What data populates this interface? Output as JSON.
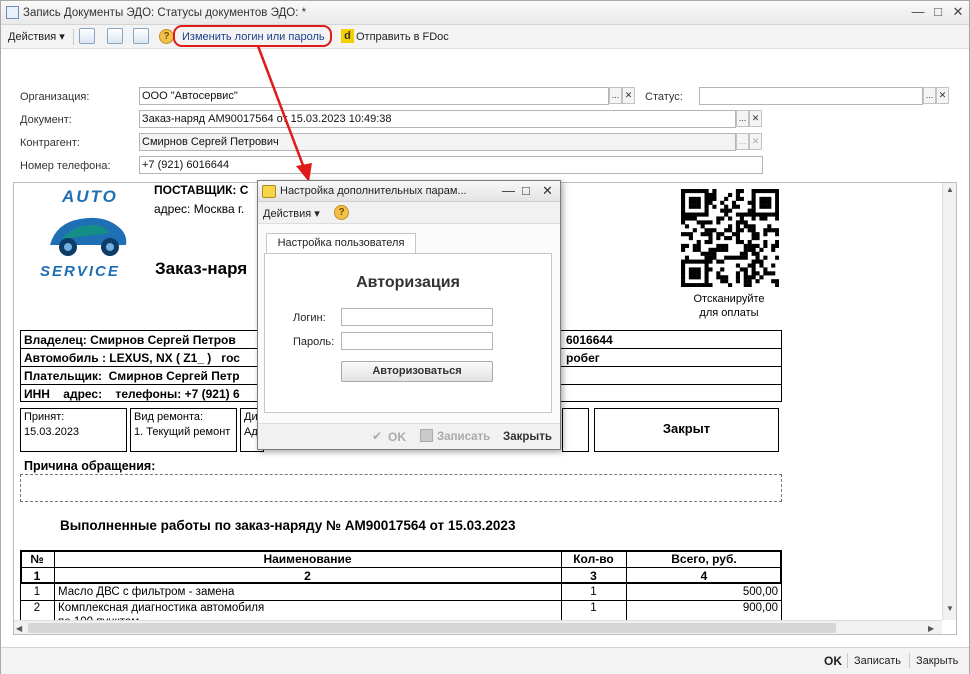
{
  "window": {
    "title": "Запись Документы ЭДО: Статусы документов ЭДО: *"
  },
  "toolbar": {
    "actions": "Действия",
    "change_login": "Изменить логин или пароль",
    "send_fdoc": "Отправить в FDoc"
  },
  "form": {
    "org_label": "Организация:",
    "org_value": "ООО \"Автосервис\"",
    "status_label": "Статус:",
    "status_value": "",
    "doc_label": "Документ:",
    "doc_value": "Заказ-наряд АМ90017564 от 15.03.2023 10:49:38",
    "contr_label": "Контрагент:",
    "contr_value": "Смирнов Сергей Петрович",
    "phone_label": "Номер телефона:",
    "phone_value": "+7 (921) 6016644"
  },
  "document": {
    "logo_top": "AUTO",
    "logo_bottom": "SERVICE",
    "supplier": "ПОСТАВЩИК:  С",
    "address": "адрес: Москва г.",
    "order_title": "Заказ-наря",
    "qr_caption1": "Отсканируйте",
    "qr_caption2": "для оплаты",
    "owner": "Владелец: Смирнов Сергей Петров",
    "owner_tail": "6016644",
    "car": "Автомобиль : LEXUS, NX ( Z1_ )   гос",
    "car_tail": "робег",
    "payer": "Плательщик:  Смирнов Сергей Петр",
    "inn": "ИНН    адрес:    телефоны: +7 (921) 6",
    "accepted_label": "Принят:",
    "accepted_value": "15.03.2023",
    "repair_label": "Вид ремонта:",
    "repair_value": "1. Текущий ремонт",
    "d_label": "Ди",
    "d_value": "Ад",
    "closed": "Закрыт",
    "reason": "Причина обращения:",
    "works_title": "Выполненные работы по заказ-наряду №  АМ90017564 от 15.03.2023",
    "table": {
      "headers": [
        "№",
        "Наименование",
        "Кол-во",
        "Всего, руб."
      ],
      "numbers": [
        "1",
        "2",
        "3",
        "4"
      ],
      "rows": [
        [
          "1",
          "Масло ДВС с фильтром - замена",
          "1",
          "500,00"
        ],
        [
          "2",
          "Комплексная диагностика автомобиля",
          "1",
          "900,00"
        ]
      ],
      "cut_text": "по 100 пунктам"
    }
  },
  "dialog": {
    "title": "Настройка дополнительных парам...",
    "actions": "Действия",
    "tab": "Настройка пользователя",
    "heading": "Авторизация",
    "login_label": "Логин:",
    "password_label": "Пароль:",
    "login_value": "",
    "password_value": "",
    "auth_button": "Авторизоваться",
    "ok": "OK",
    "save": "Записать",
    "close": "Закрыть"
  },
  "footer": {
    "ok": "OK",
    "save": "Записать",
    "close": "Закрыть"
  },
  "colors": {
    "annotation": "#e11a1a",
    "logo_blue": "#1f6fb5",
    "logo_teal": "#138f86"
  }
}
